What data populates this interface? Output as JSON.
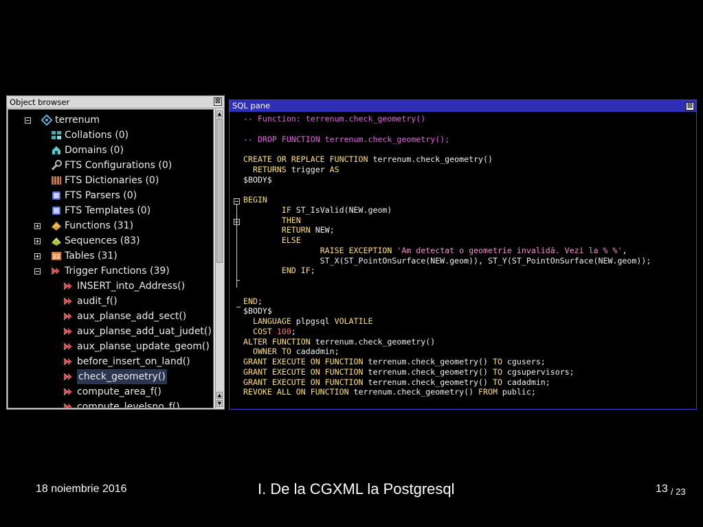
{
  "object_browser": {
    "title": "Object browser",
    "close_glyph": "⊠",
    "tree": [
      {
        "label": "terrenum",
        "icon": "schema-icon",
        "color": "#5fb0d8",
        "expander": "minus",
        "indent": 0
      },
      {
        "label": "Collations (0)",
        "icon": "collation-icon",
        "color": "#3fb0b0",
        "expander": "",
        "indent": 1
      },
      {
        "label": "Domains (0)",
        "icon": "domain-icon",
        "color": "#5fc8c8",
        "expander": "",
        "indent": 1
      },
      {
        "label": "FTS Configurations (0)",
        "icon": "fts-configuration-icon",
        "color": "#b8b8b8",
        "expander": "",
        "indent": 1
      },
      {
        "label": "FTS Dictionaries (0)",
        "icon": "fts-dictionary-icon",
        "color": "#e0702a",
        "expander": "",
        "indent": 1
      },
      {
        "label": "FTS Parsers (0)",
        "icon": "fts-parser-icon",
        "color": "#5a6ae0",
        "expander": "",
        "indent": 1
      },
      {
        "label": "FTS Templates (0)",
        "icon": "fts-template-icon",
        "color": "#5a7ae8",
        "expander": "",
        "indent": 1
      },
      {
        "label": "Functions (31)",
        "icon": "function-icon",
        "color": "#d9a030",
        "expander": "plus",
        "indent": 1
      },
      {
        "label": "Sequences (83)",
        "icon": "sequence-icon",
        "color": "#a8c040",
        "expander": "plus",
        "indent": 1
      },
      {
        "label": "Tables (31)",
        "icon": "table-icon",
        "color": "#e07830",
        "expander": "plus",
        "indent": 1
      },
      {
        "label": "Trigger Functions (39)",
        "icon": "trigger-function-icon",
        "color": "#e04848",
        "expander": "minus",
        "indent": 1
      },
      {
        "label": "INSERT_into_Address()",
        "icon": "trigger-function-icon",
        "color": "#e04848",
        "expander": "",
        "indent": 2
      },
      {
        "label": "audit_f()",
        "icon": "trigger-function-icon",
        "color": "#e04848",
        "expander": "",
        "indent": 2
      },
      {
        "label": "aux_planse_add_sect()",
        "icon": "trigger-function-icon",
        "color": "#e04848",
        "expander": "",
        "indent": 2
      },
      {
        "label": "aux_planse_add_uat_judet()",
        "icon": "trigger-function-icon",
        "color": "#e04848",
        "expander": "",
        "indent": 2
      },
      {
        "label": "aux_planse_update_geom()",
        "icon": "trigger-function-icon",
        "color": "#e04848",
        "expander": "",
        "indent": 2
      },
      {
        "label": "before_insert_on_land()",
        "icon": "trigger-function-icon",
        "color": "#e04848",
        "expander": "",
        "indent": 2
      },
      {
        "label": "check_geometry()",
        "icon": "trigger-function-icon",
        "color": "#e04848",
        "expander": "",
        "indent": 2,
        "selected": true
      },
      {
        "label": "compute_area_f()",
        "icon": "trigger-function-icon",
        "color": "#e04848",
        "expander": "",
        "indent": 2
      },
      {
        "label": "compute_levelsno_f()",
        "icon": "trigger-function-icon",
        "color": "#e04848",
        "expander": "",
        "indent": 2
      }
    ]
  },
  "sql_pane": {
    "title": "SQL pane",
    "close_glyph": "⊠",
    "lines": [
      [
        [
          "cm",
          "-- Function: terrenum.check_geometry()"
        ]
      ],
      [],
      [
        [
          "cm",
          "-- DROP FUNCTION terrenum.check_geometry();"
        ]
      ],
      [],
      [
        [
          "kw",
          "CREATE OR REPLACE FUNCTION"
        ],
        [
          "",
          " terrenum.check_geometry()"
        ]
      ],
      [
        [
          "",
          "  "
        ],
        [
          "kw",
          "RETURNS"
        ],
        [
          "",
          " trigger "
        ],
        [
          "kw",
          "AS"
        ]
      ],
      [
        [
          "",
          "$BODY$"
        ]
      ],
      [],
      [
        [
          "kw",
          "BEGIN"
        ]
      ],
      [
        [
          "",
          "        "
        ],
        [
          "kw",
          "IF"
        ],
        [
          "",
          " ST_IsValid(NEW.geom)"
        ]
      ],
      [
        [
          "",
          "        "
        ],
        [
          "kw",
          "THEN"
        ]
      ],
      [
        [
          "",
          "        "
        ],
        [
          "kw",
          "RETURN"
        ],
        [
          "",
          " NEW;"
        ]
      ],
      [
        [
          "",
          "        "
        ],
        [
          "kw",
          "ELSE"
        ]
      ],
      [
        [
          "",
          "                "
        ],
        [
          "kw",
          "RAISE EXCEPTION"
        ],
        [
          "",
          " "
        ],
        [
          "str",
          "'Am detectat o geometrie invalidă. Vezi la % %'"
        ],
        [
          "",
          ","
        ]
      ],
      [
        [
          "",
          "                ST_X(ST_PointOnSurface(NEW.geom)), ST_Y(ST_PointOnSurface(NEW.geom));"
        ]
      ],
      [
        [
          "",
          "        "
        ],
        [
          "kw",
          "END IF"
        ],
        [
          "",
          ";"
        ]
      ],
      [],
      [],
      [
        [
          "kw",
          "END"
        ],
        [
          "",
          ";"
        ]
      ],
      [
        [
          "",
          "$BODY$"
        ]
      ],
      [
        [
          "",
          "  "
        ],
        [
          "kw",
          "LANGUAGE"
        ],
        [
          "",
          " plpgsql "
        ],
        [
          "kw",
          "VOLATILE"
        ]
      ],
      [
        [
          "",
          "  "
        ],
        [
          "kw",
          "COST"
        ],
        [
          "",
          " "
        ],
        [
          "num",
          "100"
        ],
        [
          "",
          ";"
        ]
      ],
      [
        [
          "kw",
          "ALTER FUNCTION"
        ],
        [
          "",
          " terrenum.check_geometry()"
        ]
      ],
      [
        [
          "",
          "  "
        ],
        [
          "kw",
          "OWNER TO"
        ],
        [
          "",
          " cadadmin;"
        ]
      ],
      [
        [
          "kw",
          "GRANT EXECUTE ON FUNCTION"
        ],
        [
          "",
          " terrenum.check_geometry() "
        ],
        [
          "kw",
          "TO"
        ],
        [
          "",
          " cgusers;"
        ]
      ],
      [
        [
          "kw",
          "GRANT EXECUTE ON FUNCTION"
        ],
        [
          "",
          " terrenum.check_geometry() "
        ],
        [
          "kw",
          "TO"
        ],
        [
          "",
          " cgsupervisors;"
        ]
      ],
      [
        [
          "kw",
          "GRANT EXECUTE ON FUNCTION"
        ],
        [
          "",
          " terrenum.check_geometry() "
        ],
        [
          "kw",
          "TO"
        ],
        [
          "",
          " cadadmin;"
        ]
      ],
      [
        [
          "kw",
          "REVOKE ALL ON FUNCTION"
        ],
        [
          "",
          " terrenum.check_geometry() "
        ],
        [
          "kw",
          "FROM"
        ],
        [
          "",
          " public;"
        ]
      ]
    ]
  },
  "footer": {
    "date": "18 noiembrie 2016",
    "title": "I. De la CGXML la Postgresql",
    "page": "13",
    "total": "/ 23"
  }
}
